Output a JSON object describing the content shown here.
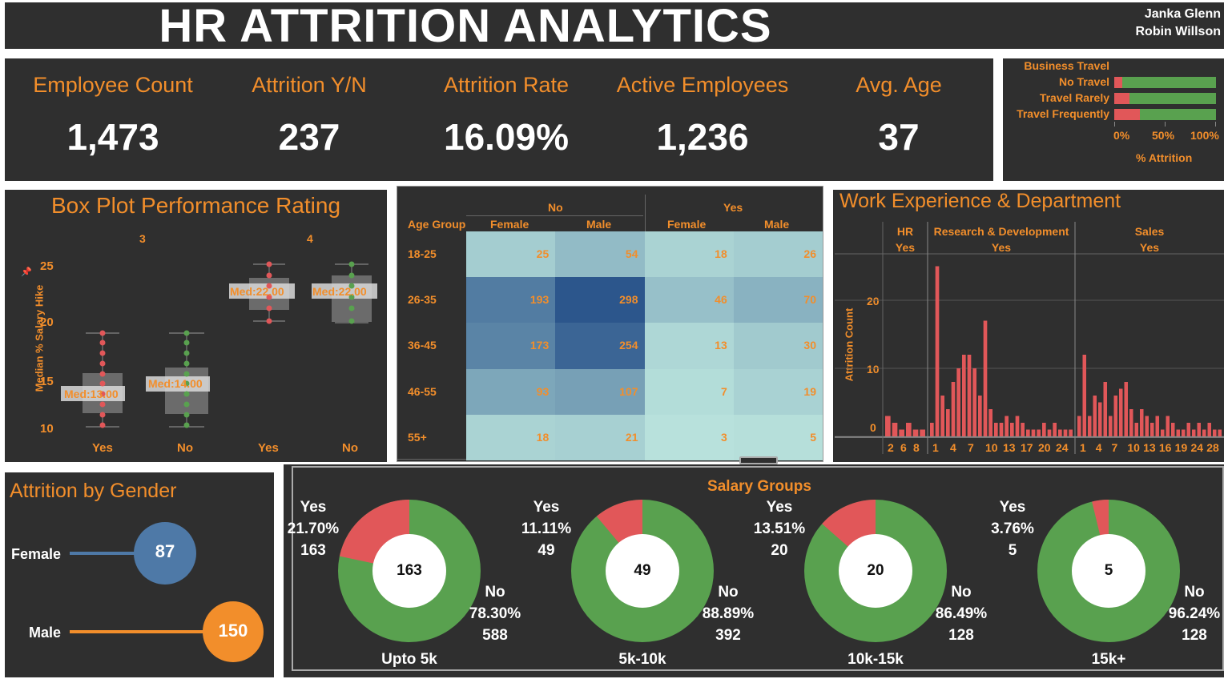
{
  "header": {
    "title": "HR ATTRITION ANALYTICS",
    "authors": [
      "Janka Glenn",
      "Robin Willson"
    ]
  },
  "kpis": [
    {
      "label": "Employee Count",
      "value": "1,473"
    },
    {
      "label": "Attrition Y/N",
      "value": "237"
    },
    {
      "label": "Attrition Rate",
      "value": "16.09%"
    },
    {
      "label": "Active Employees",
      "value": "1,236"
    },
    {
      "label": "Avg. Age",
      "value": "37"
    }
  ],
  "colors": {
    "panel": "#2f2f2f",
    "accent": "#f28e2b",
    "attrition_yes": "#e15759",
    "attrition_no": "#59a14f",
    "female": "#4e79a7",
    "male": "#f28e2b"
  },
  "travel": {
    "title": "Business Travel",
    "xlabel": "% Attrition",
    "ticks": [
      "0%",
      "50%",
      "100%"
    ],
    "rows": [
      {
        "label": "No Travel",
        "attrition_pct": 8
      },
      {
        "label": "Travel Rarely",
        "attrition_pct": 15
      },
      {
        "label": "Travel Frequently",
        "attrition_pct": 25
      }
    ]
  },
  "boxplot": {
    "title": "Box Plot Performance Rating",
    "ylabel": "Median % Salary Hike",
    "groups": [
      "3",
      "4"
    ],
    "yticks": [
      "25",
      "20",
      "15",
      "10"
    ],
    "pin": "📌",
    "boxes": [
      {
        "label": "Yes",
        "median": "Med:13.00",
        "color": "#e15759"
      },
      {
        "label": "No",
        "median": "Med:14.00",
        "color": "#59a14f"
      },
      {
        "label": "Yes",
        "median": "Med:22.00",
        "color": "#e15759"
      },
      {
        "label": "No",
        "median": "Med:22.00",
        "color": "#59a14f"
      }
    ]
  },
  "chart_data": [
    {
      "type": "heatmap",
      "col_groups": [
        "No",
        "Yes"
      ],
      "col_headers": [
        "Female",
        "Male",
        "Female",
        "Male"
      ],
      "row_header": "Age Group",
      "rows": [
        "18-25",
        "26-35",
        "36-45",
        "46-55",
        "55+"
      ],
      "values": [
        [
          25,
          54,
          18,
          26
        ],
        [
          193,
          298,
          46,
          70
        ],
        [
          173,
          254,
          13,
          30
        ],
        [
          93,
          107,
          7,
          19
        ],
        [
          18,
          21,
          3,
          5
        ]
      ],
      "value_labels": [
        [
          "25",
          "54",
          "18",
          "26"
        ],
        [
          "193",
          "298",
          "46",
          "70"
        ],
        [
          "173",
          "254",
          "13",
          "30"
        ],
        [
          "93",
          "107",
          "7",
          "19"
        ],
        [
          "18",
          "21",
          "3",
          "5"
        ]
      ]
    },
    {
      "type": "bar",
      "title": "Work Experience & Department",
      "ylabel": "Attrition Count",
      "yticks": [
        "20",
        "10",
        "0"
      ],
      "ylim": [
        0,
        27
      ],
      "panels": [
        {
          "dept": "HR",
          "sub": "Yes",
          "xticks": [
            "2",
            "6",
            "8"
          ],
          "values": [
            3,
            2,
            1,
            2,
            1,
            1
          ]
        },
        {
          "dept": "Research & Development",
          "sub": "Yes",
          "xticks": [
            "1",
            "4",
            "7",
            "10",
            "13",
            "17",
            "20",
            "24"
          ],
          "values": [
            2,
            25,
            6,
            4,
            8,
            10,
            12,
            12,
            10,
            6,
            17,
            4,
            2,
            2,
            3,
            2,
            3,
            2,
            1,
            1,
            1,
            2,
            1,
            2,
            1,
            1,
            1
          ]
        },
        {
          "dept": "Sales",
          "sub": "Yes",
          "xticks": [
            "1",
            "4",
            "7",
            "10",
            "13",
            "16",
            "19",
            "24",
            "28"
          ],
          "values": [
            3,
            12,
            3,
            6,
            5,
            8,
            3,
            6,
            7,
            8,
            4,
            2,
            4,
            3,
            2,
            3,
            1,
            3,
            2,
            1,
            1,
            2,
            1,
            2,
            1,
            2,
            1,
            1
          ]
        }
      ]
    }
  ],
  "gender": {
    "title": "Attrition by Gender",
    "items": [
      {
        "label": "Female",
        "value": "87",
        "count": 87
      },
      {
        "label": "Male",
        "value": "150",
        "count": 150
      }
    ]
  },
  "salary": {
    "title": "Salary Groups",
    "groups": [
      {
        "name": "Upto 5k",
        "center": "163",
        "yes_label": "Yes",
        "yes_pct": "21.70%",
        "yes_count": "163",
        "no_label": "No",
        "no_pct": "78.30%",
        "no_count": "588",
        "yes_share": 21.7
      },
      {
        "name": "5k-10k",
        "center": "49",
        "yes_label": "Yes",
        "yes_pct": "11.11%",
        "yes_count": "49",
        "no_label": "No",
        "no_pct": "88.89%",
        "no_count": "392",
        "yes_share": 11.11
      },
      {
        "name": "10k-15k",
        "center": "20",
        "yes_label": "Yes",
        "yes_pct": "13.51%",
        "yes_count": "20",
        "no_label": "No",
        "no_pct": "86.49%",
        "no_count": "128",
        "yes_share": 13.51
      },
      {
        "name": "15k+",
        "center": "5",
        "yes_label": "Yes",
        "yes_pct": "3.76%",
        "yes_count": "5",
        "no_label": "No",
        "no_pct": "96.24%",
        "no_count": "128",
        "yes_share": 3.76
      }
    ]
  }
}
